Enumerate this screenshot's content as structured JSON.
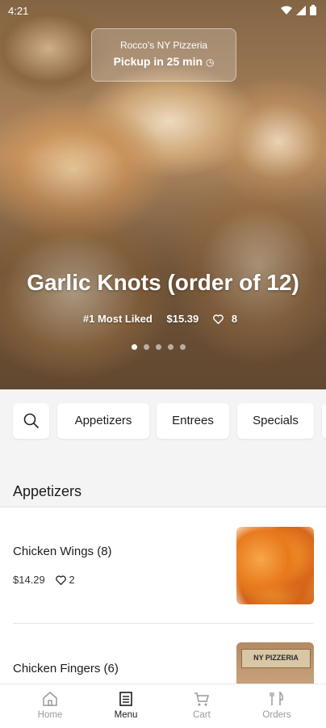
{
  "status_bar": {
    "time": "4:21"
  },
  "pickup": {
    "restaurant": "Rocco's NY Pizzeria",
    "time_label": "Pickup in 25 min",
    "clock_glyph": "◷"
  },
  "featured": {
    "title": "Garlic Knots (order of 12)",
    "rank": "#1 Most Liked",
    "price": "$15.39",
    "likes": "8",
    "carousel_total": 5,
    "carousel_active": 1
  },
  "categories": {
    "items": [
      "Appetizers",
      "Entrees",
      "Specials"
    ]
  },
  "section": {
    "title": "Appetizers"
  },
  "menu_items": [
    {
      "name": "Chicken Wings (8)",
      "price": "$14.29",
      "likes": "2"
    },
    {
      "name": "Chicken Fingers (6)",
      "image_text": "NY PIZZERIA"
    }
  ],
  "bottom_nav": {
    "items": [
      {
        "label": "Home",
        "icon": "home-icon"
      },
      {
        "label": "Menu",
        "icon": "menu-icon"
      },
      {
        "label": "Cart",
        "icon": "cart-icon"
      },
      {
        "label": "Orders",
        "icon": "orders-icon"
      }
    ],
    "active": "Menu"
  },
  "colors": {
    "active_text": "#1c1c1c",
    "inactive_text": "#9a9a9a",
    "chip_band": "#f4f4f4"
  }
}
